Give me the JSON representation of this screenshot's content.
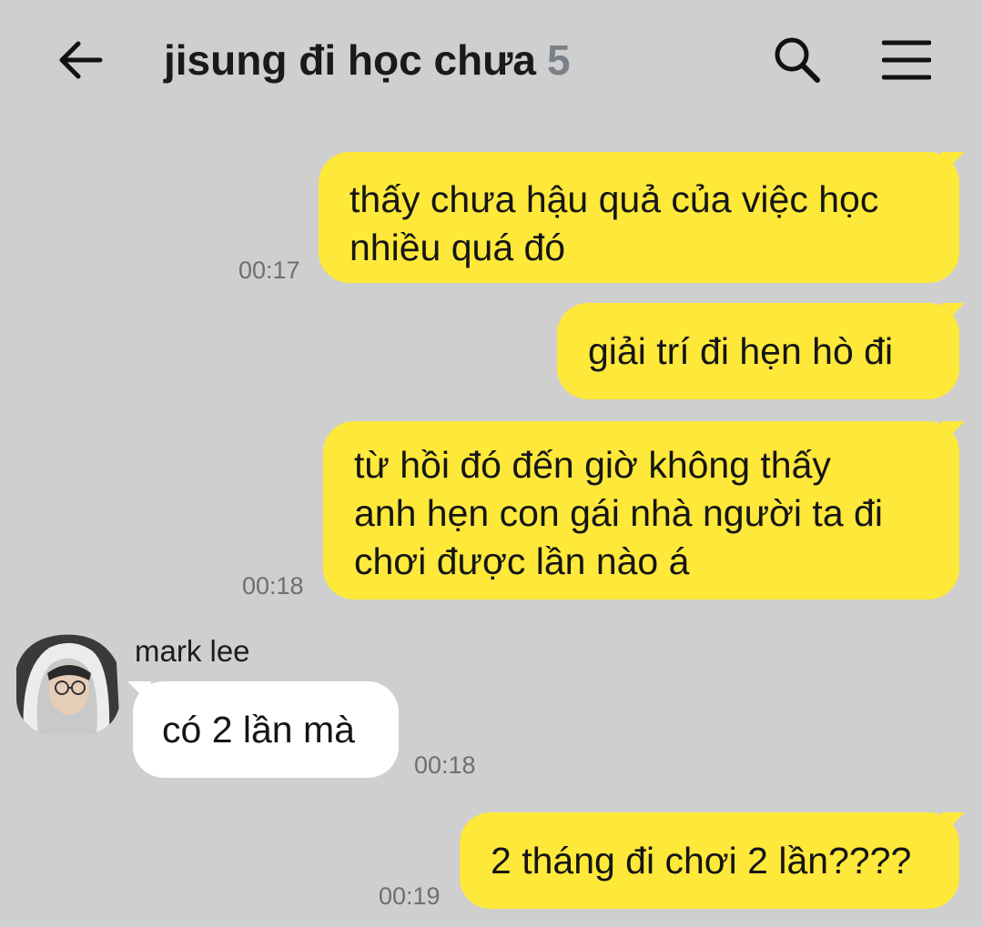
{
  "header": {
    "title": "jisung đi học chưa",
    "member_count": "5",
    "back_icon": "arrow-left-icon",
    "search_icon": "search-icon",
    "menu_icon": "hamburger-menu-icon"
  },
  "messages": [
    {
      "sender": "me",
      "lines": [
        "thấy chưa hậu quả của việc học",
        "nhiều quá đó"
      ],
      "time": "00:17"
    },
    {
      "sender": "me",
      "lines": [
        "giải trí đi hẹn hò đi"
      ]
    },
    {
      "sender": "me",
      "lines": [
        "từ hồi đó đến giờ không thấy",
        "anh hẹn con gái nhà người ta đi",
        "chơi được lần nào á"
      ],
      "time": "00:18"
    },
    {
      "sender": "mark lee",
      "lines": [
        "có 2 lần mà"
      ],
      "time": "00:18"
    },
    {
      "sender": "me",
      "lines": [
        "2 tháng đi chơi 2 lần????"
      ],
      "time": "00:19"
    }
  ],
  "colors": {
    "background": "#cfcfcf",
    "my_bubble": "#fee83a",
    "other_bubble": "#ffffff",
    "member_count": "#7b8088"
  }
}
